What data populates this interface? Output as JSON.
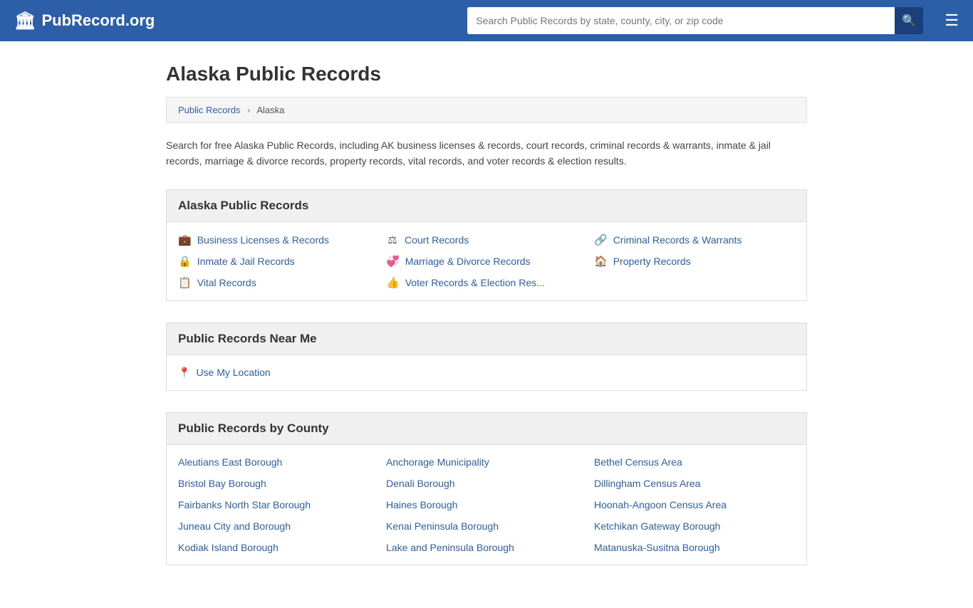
{
  "header": {
    "logo_icon": "🏛",
    "logo_text": "PubRecord.org",
    "search_placeholder": "Search Public Records by state, county, city, or zip code",
    "search_icon": "🔍",
    "menu_icon": "☰"
  },
  "page": {
    "title": "Alaska Public Records",
    "breadcrumb": {
      "parent_label": "Public Records",
      "sep": "›",
      "current": "Alaska"
    },
    "description": "Search for free Alaska Public Records, including AK business licenses & records, court records, criminal records & warrants, inmate & jail records, marriage & divorce records, property records, vital records, and voter records & election results."
  },
  "alaska_records_section": {
    "heading": "Alaska Public Records",
    "items": [
      {
        "icon": "💼",
        "label": "Business Licenses & Records"
      },
      {
        "icon": "⚖",
        "label": "Court Records"
      },
      {
        "icon": "🔗",
        "label": "Criminal Records & Warrants"
      },
      {
        "icon": "🔒",
        "label": "Inmate & Jail Records"
      },
      {
        "icon": "💞",
        "label": "Marriage & Divorce Records"
      },
      {
        "icon": "🏠",
        "label": "Property Records"
      },
      {
        "icon": "📋",
        "label": "Vital Records"
      },
      {
        "icon": "👍",
        "label": "Voter Records & Election Res..."
      }
    ]
  },
  "near_me_section": {
    "heading": "Public Records Near Me",
    "icon": "📍",
    "label": "Use My Location"
  },
  "county_section": {
    "heading": "Public Records by County",
    "counties": [
      "Aleutians East Borough",
      "Anchorage Municipality",
      "Bethel Census Area",
      "Bristol Bay Borough",
      "Denali Borough",
      "Dillingham Census Area",
      "Fairbanks North Star Borough",
      "Haines Borough",
      "Hoonah-Angoon Census Area",
      "Juneau City and Borough",
      "Kenai Peninsula Borough",
      "Ketchikan Gateway Borough",
      "Kodiak Island Borough",
      "Lake and Peninsula Borough",
      "Matanuska-Susitna Borough"
    ]
  }
}
